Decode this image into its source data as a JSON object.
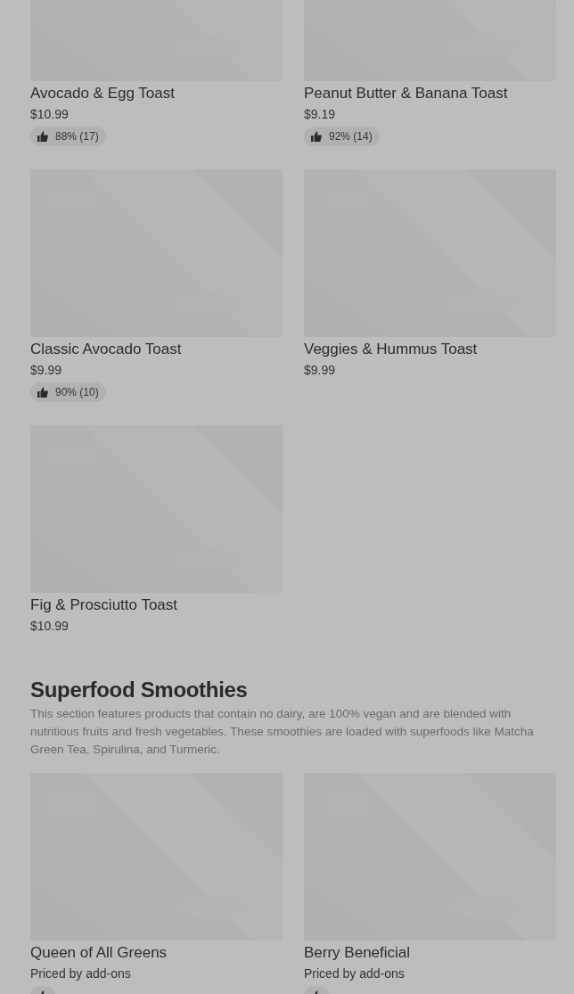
{
  "sections": [
    {
      "items": [
        {
          "name": "Avocado & Egg Toast",
          "price": "$10.99",
          "rating": "88% (17)"
        },
        {
          "name": "Peanut Butter & Banana Toast",
          "price": "$9.19",
          "rating": "92% (14)"
        },
        {
          "name": "Classic Avocado Toast",
          "price": "$9.99",
          "rating": "90% (10)"
        },
        {
          "name": "Veggies & Hummus Toast",
          "price": "$9.99"
        },
        {
          "name": "Fig & Prosciutto Toast",
          "price": "$10.99"
        }
      ]
    },
    {
      "title": "Superfood Smoothies",
      "description": "This section features products that contain no dairy, are 100% vegan and are blended with nutritious fruits and fresh vegetables. These smoothies are loaded with superfoods like Matcha Green Tea, Spirulina, and Turmeric.",
      "items": [
        {
          "name": "Queen of All Greens",
          "price": "Priced by add-ons",
          "rated": true
        },
        {
          "name": "Berry Beneficial",
          "price": "Priced by add-ons",
          "rated": true
        }
      ]
    }
  ]
}
